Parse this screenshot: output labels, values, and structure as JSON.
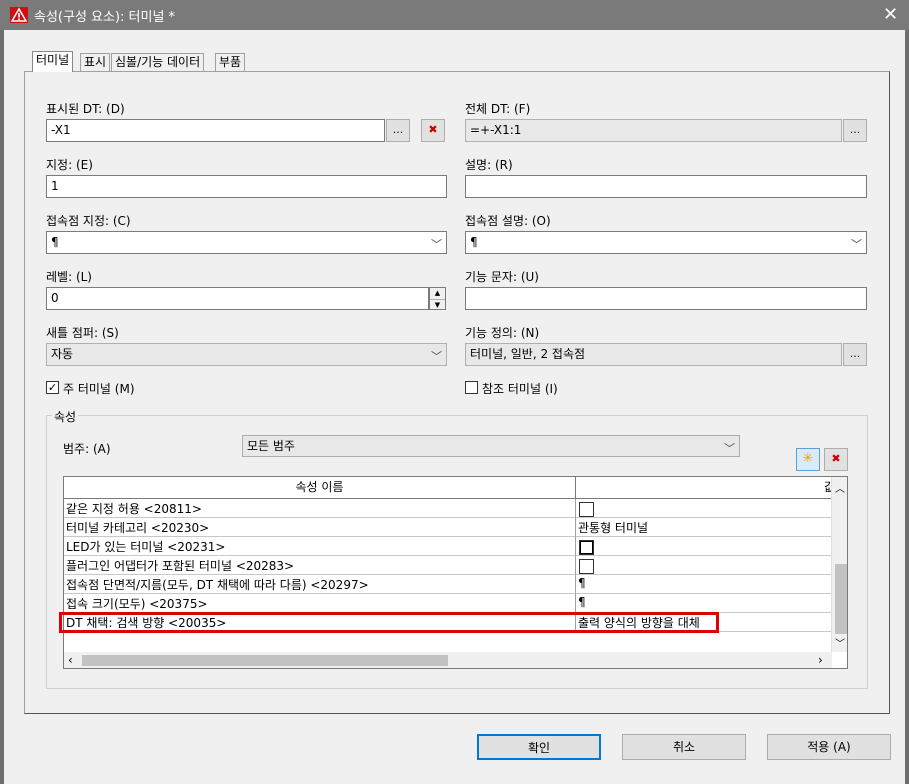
{
  "window": {
    "title": "속성(구성 요소): 터미널 *"
  },
  "tabs": [
    {
      "label": "터미널"
    },
    {
      "label": "표시"
    },
    {
      "label": "심볼/기능 데이터"
    },
    {
      "label": "부품"
    }
  ],
  "form": {
    "displayed_dt": {
      "label": "표시된 DT: (D)",
      "value": "-X1"
    },
    "full_dt": {
      "label": "전체 DT: (F)",
      "value": "=+-X1:1"
    },
    "designation": {
      "label": "지정: (E)",
      "value": "1"
    },
    "description": {
      "label": "설명: (R)",
      "value": ""
    },
    "conn_designation": {
      "label": "접속점 지정: (C)",
      "value": "¶"
    },
    "conn_description": {
      "label": "접속점 설명: (O)",
      "value": "¶"
    },
    "level": {
      "label": "레벨: (L)",
      "value": "0"
    },
    "function_text": {
      "label": "기능 문자: (U)",
      "value": ""
    },
    "new_jumper": {
      "label": "새틀 점퍼: (S)",
      "value": "자동"
    },
    "function_def": {
      "label": "기능 정의: (N)",
      "value": "터미널, 일반, 2 접속점"
    },
    "main_terminal": {
      "label": "주 터미널 (M)",
      "checked": true
    },
    "ref_terminal": {
      "label": "참조 터미널 (I)",
      "checked": false
    },
    "ellipsis": "..."
  },
  "properties": {
    "group_title": "속성",
    "category_label": "범주: (A)",
    "category_value": "모든 범주",
    "column_name": "속성 이름",
    "column_value": "값",
    "rows": [
      {
        "name": "같은 지정 허용 <20811>",
        "value": "",
        "checkbox": true
      },
      {
        "name": "터미널 카테고리 <20230>",
        "value": "관통형 터미널",
        "checkbox": false
      },
      {
        "name": "LED가 있는 터미널 <20231>",
        "value": "",
        "checkbox": true
      },
      {
        "name": "플러그인 어댑터가 포함된 터미널 <20283>",
        "value": "",
        "checkbox": true
      },
      {
        "name": "접속점 단면적/지름(모두, DT 채택에 따라 다름) <20297>",
        "value": "¶",
        "checkbox": false
      },
      {
        "name": "접속 크기(모두) <20375>",
        "value": "¶",
        "checkbox": false
      },
      {
        "name": "DT 채택: 검색 방향 <20035>",
        "value": "출력 양식의 방향을 대체",
        "checkbox": false,
        "highlighted": true
      }
    ]
  },
  "buttons": {
    "ok": "확인",
    "cancel": "취소",
    "apply": "적용 (A)"
  },
  "colors": {
    "highlight": "#e00000",
    "titlebar": "#7a7a7a",
    "ok_border": "#0078d7"
  }
}
